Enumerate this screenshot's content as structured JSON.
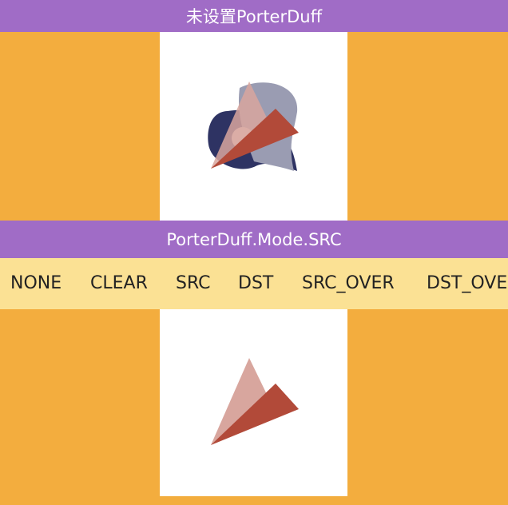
{
  "header": {
    "title": "未设置PorterDuff"
  },
  "section": {
    "title": "PorterDuff.Mode.SRC"
  },
  "modes": [
    "NONE",
    "CLEAR",
    "SRC",
    "DST",
    "SRC_OVER",
    "DST_OVER"
  ],
  "colors": {
    "background": "#F3AD3E",
    "bar": "#A06CC6",
    "tabs_bg": "#FBE194",
    "panel": "#FFFFFF",
    "dst_dark": "#2E3363",
    "dst_light": "#9A9CB2",
    "src_light": "#D8A69E",
    "src_dark": "#B24A39"
  }
}
